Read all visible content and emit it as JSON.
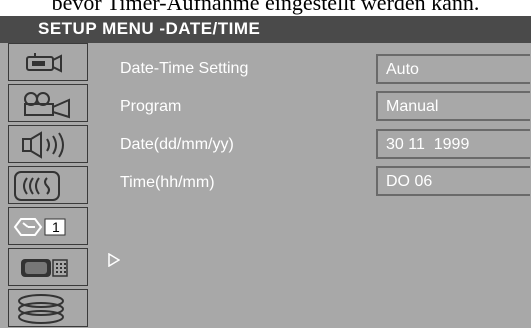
{
  "caption": "bevor Timer-Aufnahme eingestellt werden kann.",
  "menu": {
    "title": "SETUP MENU -DATE/TIME"
  },
  "sidebar": {
    "items": [
      {
        "icon": "camcorder-icon"
      },
      {
        "icon": "film-camera-icon"
      },
      {
        "icon": "speaker-icon"
      },
      {
        "icon": "radio-wave-icon"
      },
      {
        "icon": "clock-icon",
        "number": "1",
        "selected": true
      },
      {
        "icon": "tv-icon"
      },
      {
        "icon": "disc-stack-icon"
      }
    ]
  },
  "settings": [
    {
      "label": "Date-Time Setting",
      "value": "Auto"
    },
    {
      "label": "Program",
      "value": "Manual"
    },
    {
      "label": "Date(dd/mm/yy)",
      "value": "30 11  1999"
    },
    {
      "label": "Time(hh/mm)",
      "value": "DO 06"
    }
  ],
  "colors": {
    "panel": "#a8a8a8",
    "title_bar": "#4a4a4a",
    "text": "#ffffff"
  }
}
